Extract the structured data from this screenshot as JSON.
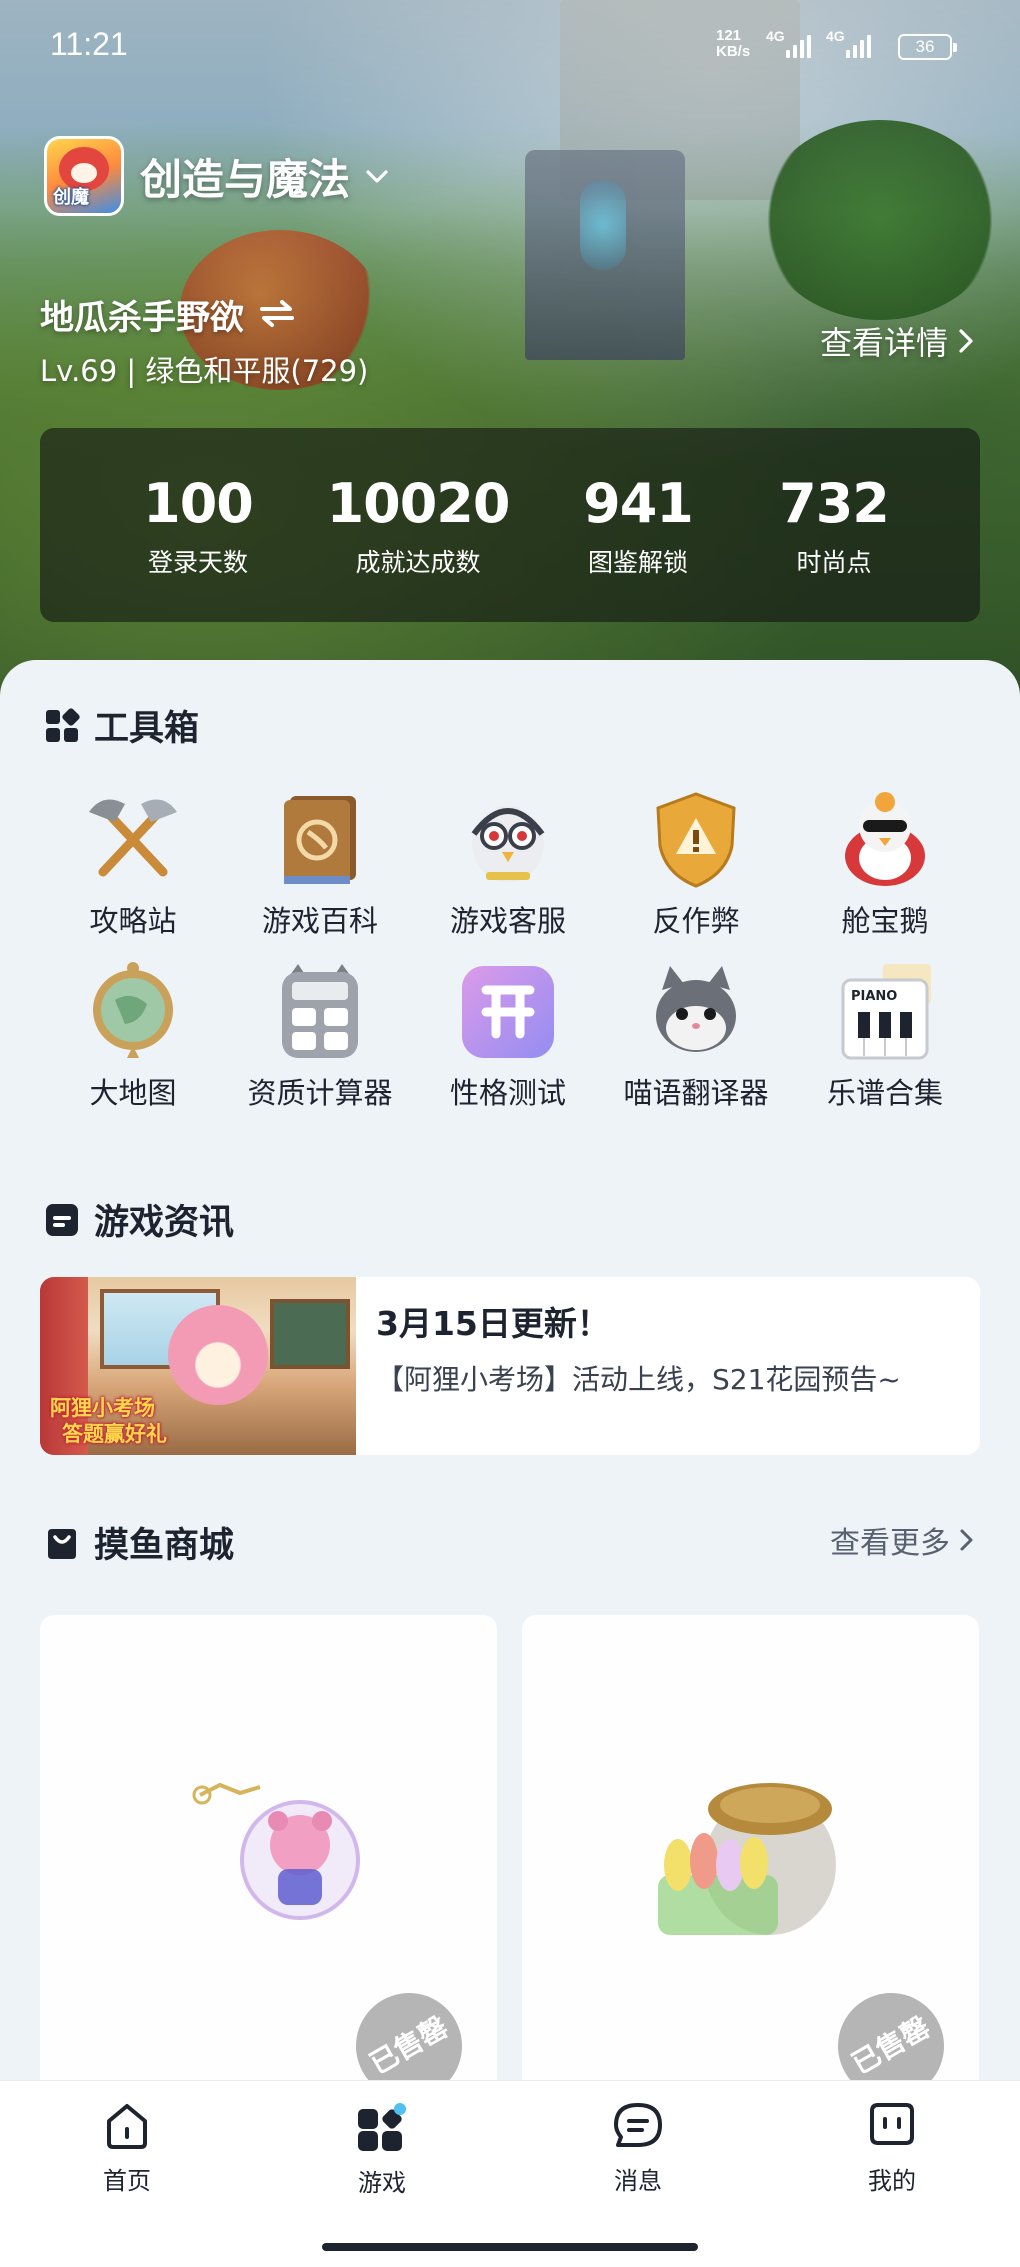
{
  "status_bar": {
    "time": "11:21",
    "net_speed_value": "121",
    "net_speed_unit": "KB/s",
    "sig1": "4G",
    "sig2": "4G",
    "battery": "36"
  },
  "header": {
    "game_name": "创造与魔法",
    "logo_text": "创魔",
    "user_name": "地瓜杀手野欲",
    "user_level": "Lv.69 | 绿色和平服(729)",
    "detail_link": "查看详情"
  },
  "stats": [
    {
      "value": "100",
      "label": "登录天数"
    },
    {
      "value": "10020",
      "label": "成就达成数"
    },
    {
      "value": "941",
      "label": "图鉴解锁"
    },
    {
      "value": "732",
      "label": "时尚点"
    }
  ],
  "toolbox": {
    "title": "工具箱",
    "items": [
      {
        "label": "攻略站",
        "icon": "crossed-axes-icon"
      },
      {
        "label": "游戏百科",
        "icon": "encyclopedia-book-icon"
      },
      {
        "label": "游戏客服",
        "icon": "support-bird-icon"
      },
      {
        "label": "反作弊",
        "icon": "warning-shield-icon"
      },
      {
        "label": "舱宝鹅",
        "icon": "goose-mascot-icon"
      },
      {
        "label": "大地图",
        "icon": "map-pin-icon"
      },
      {
        "label": "资质计算器",
        "icon": "calculator-icon"
      },
      {
        "label": "性格测试",
        "icon": "personality-test-icon"
      },
      {
        "label": "喵语翻译器",
        "icon": "cat-translator-icon"
      },
      {
        "label": "乐谱合集",
        "icon": "piano-sheet-icon"
      }
    ]
  },
  "news": {
    "title": "游戏资讯",
    "item": {
      "thumb_text_line1": "阿狸小考场",
      "thumb_text_line2": "答题赢好礼",
      "headline": "3月15日更新！",
      "summary": "【阿狸小考场】活动上线，S21花园预告~"
    }
  },
  "shop": {
    "title": "摸鱼商城",
    "more_link": "查看更多",
    "items": [
      {
        "badge": "已售罄"
      },
      {
        "badge": "已售罄"
      }
    ]
  },
  "bottom_nav": [
    {
      "label": "首页",
      "icon": "home-icon"
    },
    {
      "label": "游戏",
      "icon": "game-grid-icon",
      "active": true
    },
    {
      "label": "消息",
      "icon": "message-icon"
    },
    {
      "label": "我的",
      "icon": "profile-icon"
    }
  ]
}
